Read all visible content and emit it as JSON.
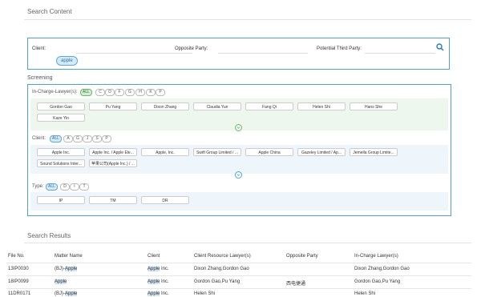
{
  "search_content": {
    "title": "Search Content",
    "client_label": "Client:",
    "opposite_label": "Opposite Party:",
    "third_label": "Potential Third Party:",
    "client_tag": "apple"
  },
  "screening": {
    "title": "Screening",
    "lawyer_label": "In-Charge-Lawyer(s):",
    "lawyer_letters": [
      "ALL",
      "C",
      "D",
      "F",
      "G",
      "H",
      "K",
      "P"
    ],
    "lawyers": [
      "Gordon Gao",
      "Pu Yang",
      "Dixon Zhang",
      "Claudia Yun",
      "Fang Qi",
      "Helen Shi",
      "Hans She",
      "Kaze Yin"
    ],
    "client_label": "Client:",
    "client_letters": [
      "ALL",
      "A",
      "G",
      "J",
      "S",
      "P"
    ],
    "clients": [
      "Apple Inc.",
      "Apple Inc. / Apple Ele...",
      "Apple, Inc.",
      "Swift Group Limited / ...",
      "Apple China",
      "Gazeley Limited / Ap...",
      "Jemella Group Limite...",
      "Sound Solutions Inter...",
      "苹果公司(Apple Inc.) / ..."
    ],
    "type_label": "Type:",
    "type_letters": [
      "ALL",
      "D",
      "I",
      "T"
    ],
    "types": [
      "IP",
      "TM",
      "DR"
    ]
  },
  "results": {
    "title": "Search Results",
    "headers": [
      "File No.",
      "Matter Name",
      "Client",
      "Client Resource Lawyer(s)",
      "Opposite Party",
      "In-Charge Lawyer(s)"
    ],
    "rows": [
      {
        "file": "13IP0030",
        "matter_pre": "(BJ)-",
        "matter_hl": "Apple",
        "client_hl": "Apple",
        "client_post": " Inc.",
        "resource": "Dixon Zhang,Gordon Gao",
        "opposite": "",
        "charge": "Dixon Zhang,Gordon Gao"
      },
      {
        "file": "18IP0099",
        "matter_pre": "",
        "matter_hl": "Apple",
        "client_hl": "Apple",
        "client_post": " Inc.",
        "resource": "Gordon Gao,Pu Yang",
        "opposite": "西电捷通",
        "charge": "Gordon Gao,Pu Yang"
      },
      {
        "file": "11DR0171",
        "matter_pre": "(BJ)-",
        "matter_hl": "Apple",
        "client_hl": "Apple",
        "client_post": " Inc.",
        "resource": "Helen Shi",
        "opposite": "",
        "charge": "Helen Shi"
      }
    ]
  }
}
